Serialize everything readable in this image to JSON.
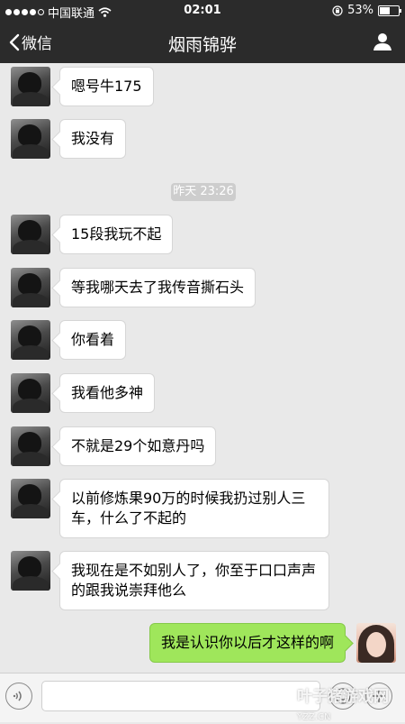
{
  "status_bar": {
    "carrier": "中国联通",
    "time": "02:01",
    "battery": "53%",
    "battery_level": 0.53
  },
  "nav": {
    "back_label": "微信",
    "title": "烟雨锦骅"
  },
  "messages": [
    {
      "type": "in",
      "text": "嗯号牛175"
    },
    {
      "type": "in",
      "text": "我没有"
    },
    {
      "type": "time",
      "text": "昨天 23:26"
    },
    {
      "type": "in",
      "text": "15段我玩不起"
    },
    {
      "type": "in",
      "text": "等我哪天去了我传音撕石头"
    },
    {
      "type": "in",
      "text": "你看着"
    },
    {
      "type": "in",
      "text": "我看他多神"
    },
    {
      "type": "in",
      "text": "不就是29个如意丹吗"
    },
    {
      "type": "in",
      "text": "以前修炼果90万的时候我扔过别人三车，什么了不起的"
    },
    {
      "type": "in",
      "text": "我现在是不如别人了，你至于口口声声的跟我说崇拜他么"
    },
    {
      "type": "out",
      "text": "我是认识你以后才这样的啊"
    }
  ],
  "input": {
    "placeholder": ""
  },
  "watermark": {
    "text": "叶子猪游戏网",
    "url": "YZZ.CN"
  },
  "colors": {
    "navbar": "#2b2b2b",
    "background": "#e9e9e9",
    "outgoing_bubble": "#9fe65b",
    "incoming_bubble": "#ffffff"
  }
}
